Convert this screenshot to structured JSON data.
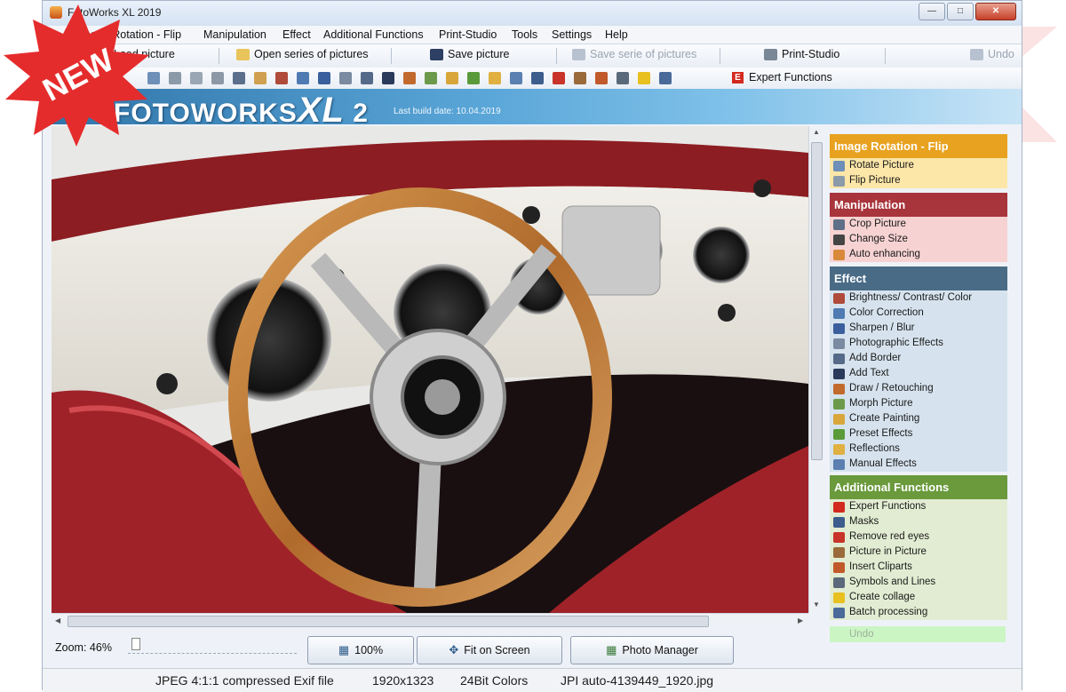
{
  "window": {
    "title": "FotoWorks XL 2019"
  },
  "menu": [
    "Image Rotation - Flip",
    "Manipulation",
    "Effect",
    "Additional Functions",
    "Print-Studio",
    "Tools",
    "Settings",
    "Help"
  ],
  "toolbar": {
    "load": "Load picture",
    "open_series": "Open series of pictures",
    "save": "Save picture",
    "save_series": "Save serie of pictures",
    "print_studio": "Print-Studio",
    "undo": "Undo",
    "expert": "Expert Functions"
  },
  "banner": {
    "brand_prefix": "FOTOWORKS",
    "brand_xl": "XL",
    "brand_num": "2",
    "build": "Last build date: 10.04.2019"
  },
  "badge": {
    "text": "NEW"
  },
  "panel": {
    "sections": [
      {
        "title": "Image Rotation - Flip",
        "items": [
          "Rotate Picture",
          "Flip Picture"
        ]
      },
      {
        "title": "Manipulation",
        "items": [
          "Crop Picture",
          "Change Size",
          "Auto enhancing"
        ]
      },
      {
        "title": "Effect",
        "items": [
          "Brightness/ Contrast/ Color",
          "Color Correction",
          "Sharpen / Blur",
          "Photographic Effects",
          "Add Border",
          "Add Text",
          "Draw / Retouching",
          "Morph Picture",
          "Create Painting",
          "Preset Effects",
          "Reflections",
          "Manual Effects"
        ]
      },
      {
        "title": "Additional Functions",
        "items": [
          "Expert Functions",
          "Masks",
          "Remove red eyes",
          "Picture in Picture",
          "Insert Cliparts",
          "Symbols and Lines",
          "Create collage",
          "Batch processing"
        ]
      }
    ],
    "undo": "Undo"
  },
  "zoom": {
    "label": "Zoom:",
    "value": "46%",
    "level": 0.02
  },
  "buttons": {
    "hundred": "100%",
    "fit": "Fit on Screen",
    "manager": "Photo Manager"
  },
  "status": {
    "format": "JPEG 4:1:1 compressed Exif file",
    "dims": "1920x1323",
    "colors": "24Bit Colors",
    "file": "JPI auto-4139449_1920.jpg"
  },
  "colors": {
    "rotation": "#e8a220",
    "manipulation": "#a8343c",
    "effect": "#4a6b86",
    "additional": "#6a9a3c"
  }
}
